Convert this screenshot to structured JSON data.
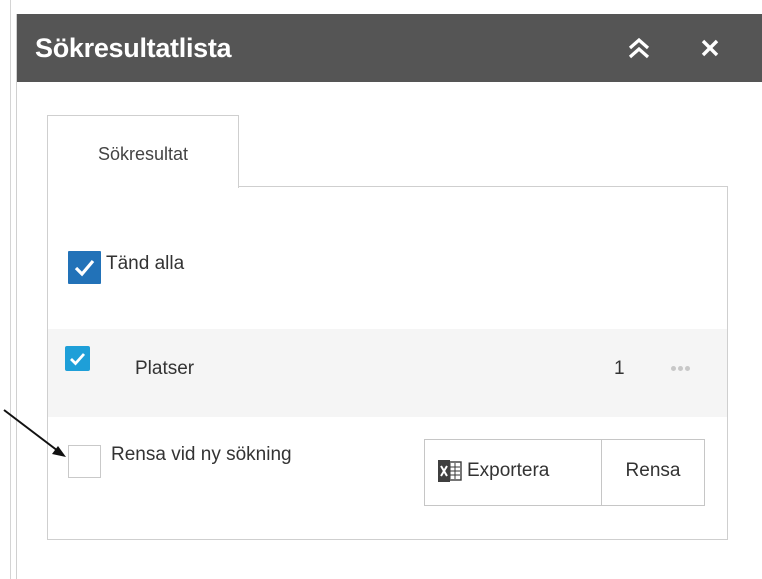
{
  "panel": {
    "title": "Sökresultatlista",
    "collapse_icon": "double-chevron-up-icon",
    "close_icon": "close-icon",
    "header_color": "#555555"
  },
  "tabs": [
    {
      "label": "Sökresultat",
      "active": true
    }
  ],
  "results": {
    "toggle_all": {
      "label": "Tänd alla",
      "checked": true
    },
    "layers": [
      {
        "name": "Platser",
        "count": "1",
        "checked": true,
        "menu_icon": "more-dots-icon"
      }
    ],
    "clear_on_new_search": {
      "label": "Rensa vid ny sökning",
      "checked": false
    },
    "buttons": {
      "export": {
        "label": "Exportera",
        "icon": "excel-icon"
      },
      "clear": {
        "label": "Rensa"
      }
    }
  },
  "colors": {
    "accent": "#2272b8",
    "layer_checkbox": "#1e9fd8",
    "row_highlight": "#f5f5f5"
  }
}
